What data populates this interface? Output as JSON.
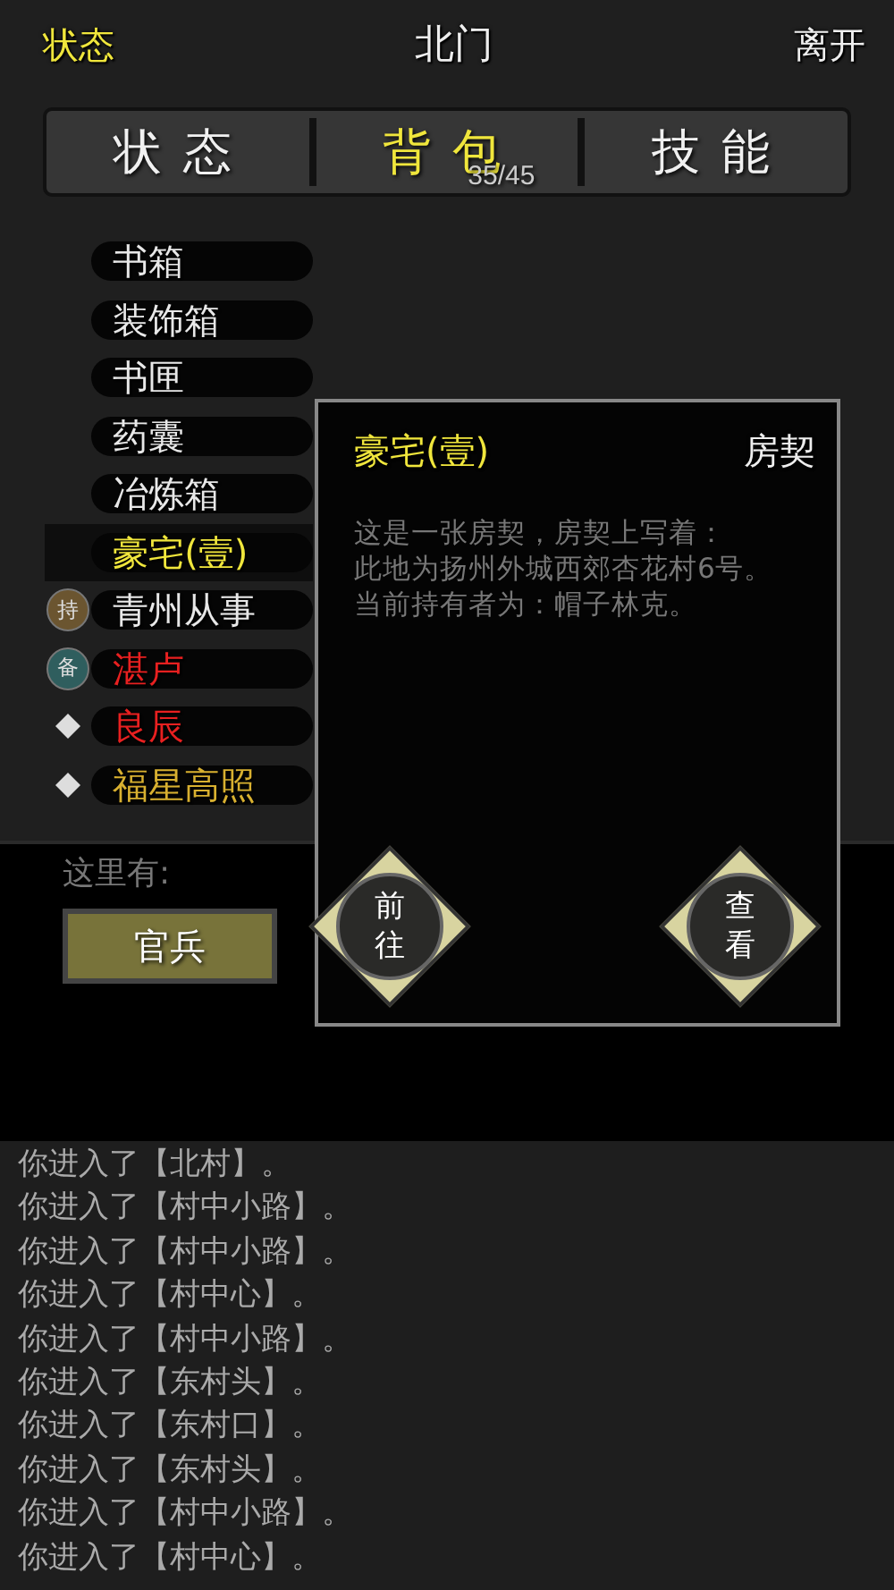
{
  "header": {
    "left": "状态",
    "title": "北门",
    "right": "离开"
  },
  "tabs": [
    {
      "label": "状态",
      "selected": false
    },
    {
      "label": "背包",
      "selected": true,
      "count": "35/45"
    },
    {
      "label": "技能",
      "selected": false
    }
  ],
  "items": [
    {
      "name": "书箱",
      "color": "#e8e8e8",
      "selected": false,
      "kind": "plain"
    },
    {
      "name": "装饰箱",
      "color": "#e8e8e8",
      "selected": false,
      "kind": "plain"
    },
    {
      "name": "书匣",
      "color": "#e8e8e8",
      "selected": false,
      "kind": "plain"
    },
    {
      "name": "药囊",
      "color": "#e8e8e8",
      "selected": false,
      "kind": "plain"
    },
    {
      "name": "冶炼箱",
      "color": "#e8e8e8",
      "selected": false,
      "kind": "plain"
    },
    {
      "name": "豪宅(壹)",
      "color": "#f0e63c",
      "selected": true,
      "kind": "plain"
    },
    {
      "name": "青州从事",
      "color": "#e8e8e8",
      "selected": false,
      "kind": "badge",
      "badge": {
        "text": "持",
        "color": "#6b5530"
      }
    },
    {
      "name": "湛卢",
      "color": "#e82020",
      "selected": false,
      "kind": "badge",
      "badge": {
        "text": "备",
        "color": "#2f5e5e"
      }
    },
    {
      "name": "良辰",
      "color": "#e82020",
      "selected": false,
      "kind": "diamond"
    },
    {
      "name": "福星高照",
      "color": "#d8b030",
      "selected": false,
      "kind": "diamond"
    }
  ],
  "here": {
    "label": "这里有:",
    "npcs": [
      "官兵"
    ]
  },
  "popup": {
    "name": "豪宅(壹)",
    "type": "房契",
    "description": [
      "这是一张房契，房契上写着：",
      "此地为扬州外城西郊杏花村6号。",
      "当前持有者为：帽子林克。"
    ],
    "actions": [
      "前往",
      "查看"
    ]
  },
  "log": [
    "你进入了【北村】。",
    "你进入了【村中小路】。",
    "你进入了【村中小路】。",
    "你进入了【村中心】。",
    "你进入了【村中小路】。",
    "你进入了【东村头】。",
    "你进入了【东村口】。",
    "你进入了【东村头】。",
    "你进入了【村中小路】。",
    "你进入了【村中心】。"
  ]
}
